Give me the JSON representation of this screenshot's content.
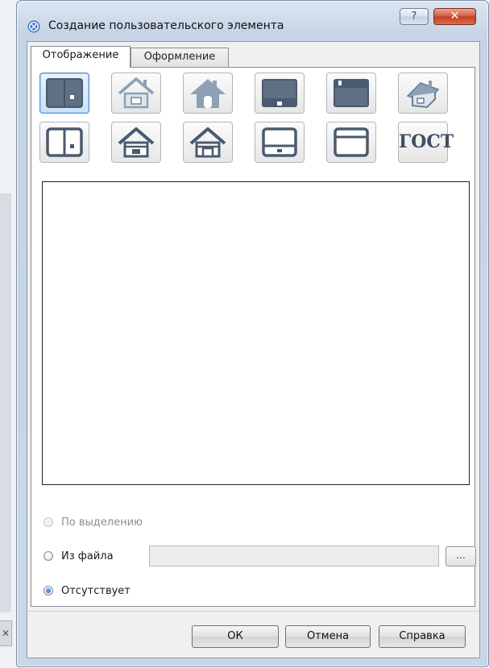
{
  "dialog": {
    "title": "Создание пользовательского элемента",
    "help_label": "?",
    "close_label": "✕"
  },
  "tabs": [
    {
      "label": "Отображение",
      "active": true
    },
    {
      "label": "Оформление",
      "active": false
    }
  ],
  "icon_buttons": [
    {
      "name": "block-filled-icon",
      "selected": true
    },
    {
      "name": "house-outline-light-icon"
    },
    {
      "name": "house-door-light-icon"
    },
    {
      "name": "panel-bottom-filled-icon"
    },
    {
      "name": "panel-top-filled-icon"
    },
    {
      "name": "house-3d-icon"
    },
    {
      "name": "block-outline-icon"
    },
    {
      "name": "house-outline-icon"
    },
    {
      "name": "house-empty-outline-icon"
    },
    {
      "name": "panel-bottom-outline-icon"
    },
    {
      "name": "panel-top-outline-icon"
    },
    {
      "name": "gost-icon",
      "text": "ГОСТ"
    }
  ],
  "source_options": [
    {
      "label": "По выделению",
      "checked": false,
      "disabled": true
    },
    {
      "label": "Из файла",
      "checked": false,
      "disabled": false
    },
    {
      "label": "Отсутствует",
      "checked": true,
      "disabled": false
    }
  ],
  "file_input": {
    "value": ""
  },
  "browse_label": "...",
  "buttons": {
    "ok": "ОК",
    "cancel": "Отмена",
    "help": "Справка"
  },
  "colors": {
    "icon_dark": "#4a5a6f",
    "icon_light": "#8ea0b5",
    "selected_border": "#5b8fd1",
    "close_red": "#c74a2f"
  }
}
